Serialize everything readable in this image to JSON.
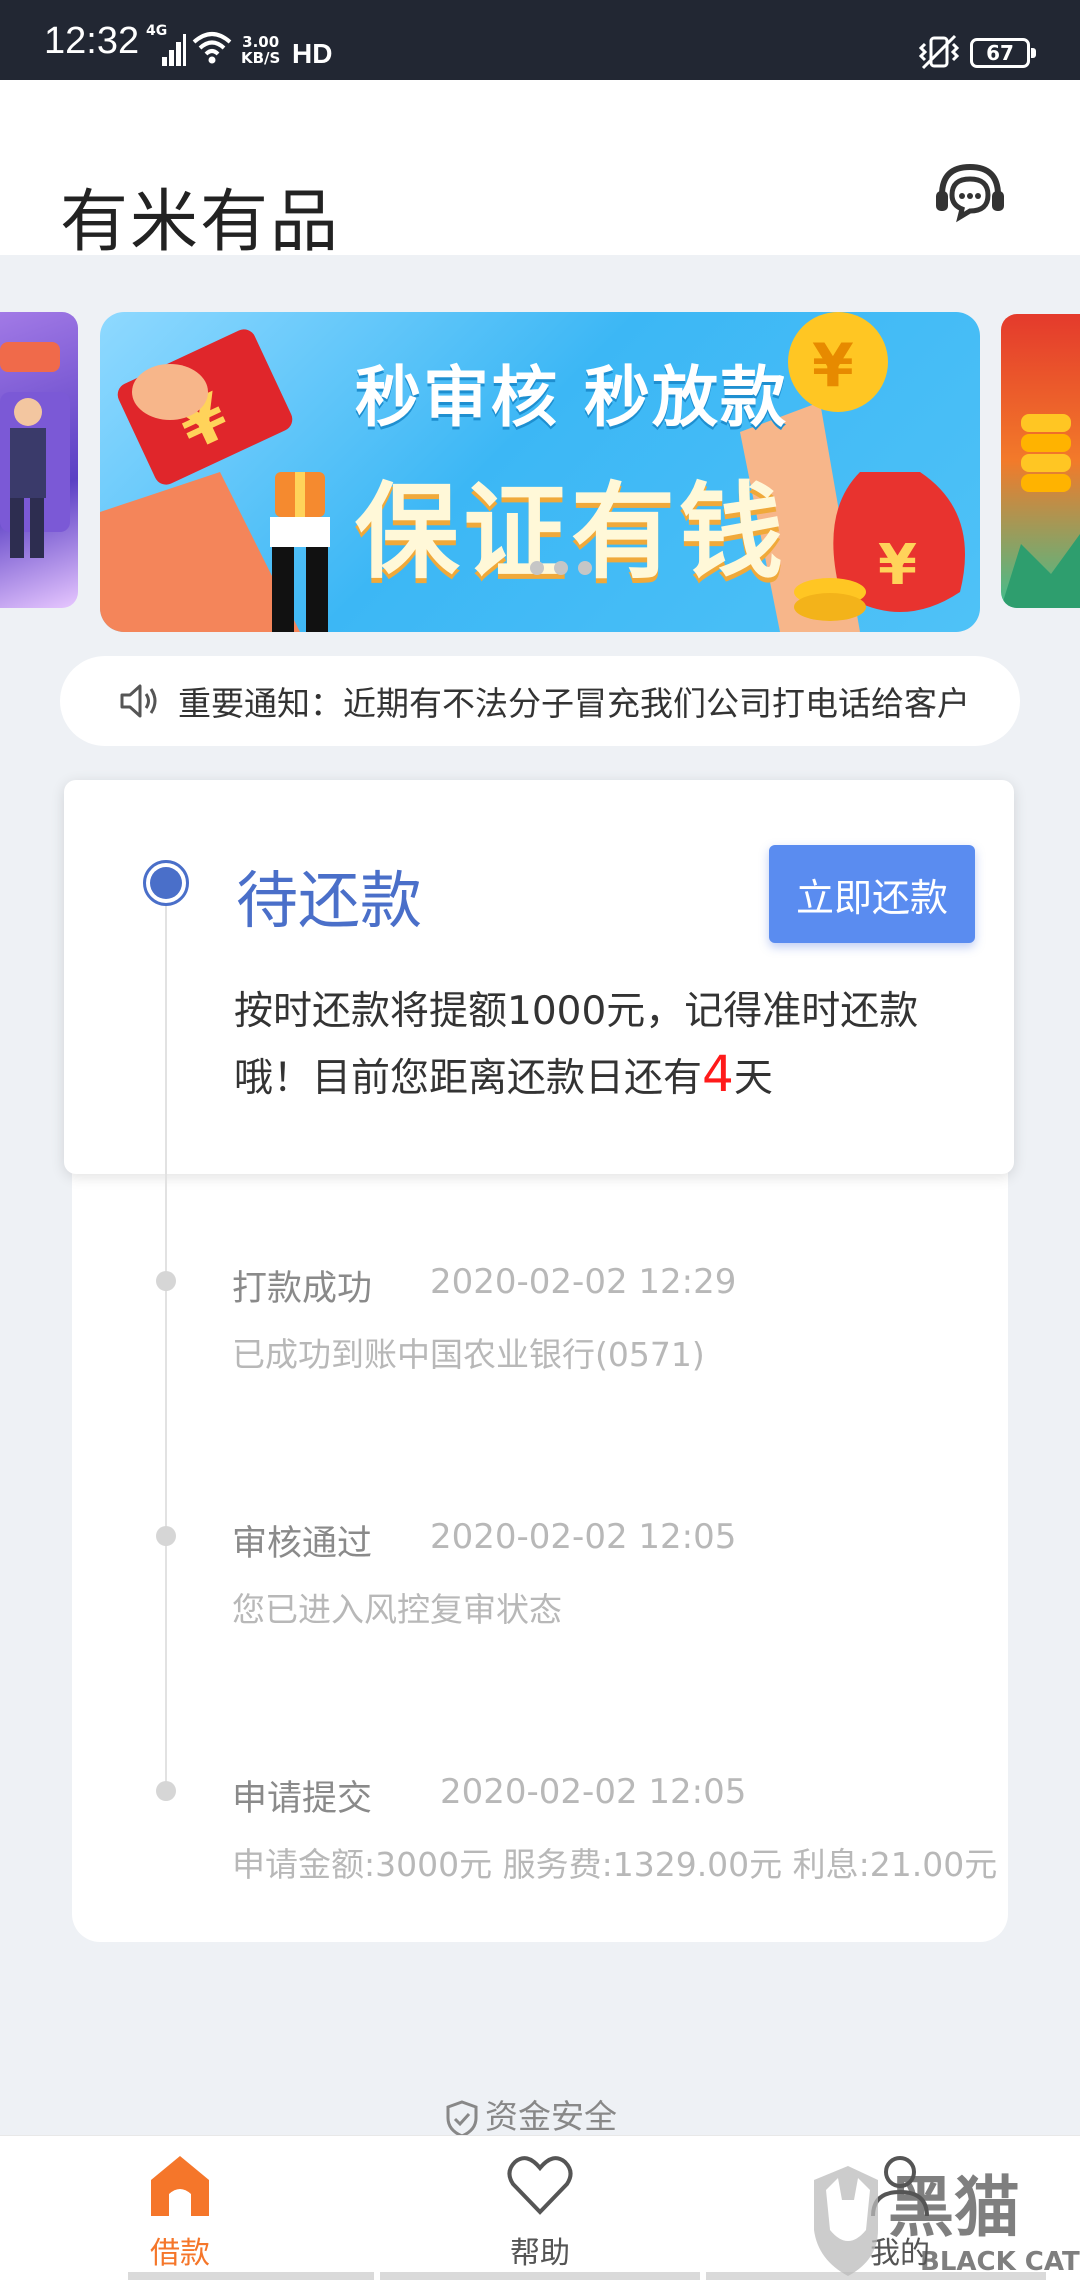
{
  "status_bar": {
    "time": "12:32",
    "network": "4G",
    "speed_value": "3.00",
    "speed_unit": "KB/S",
    "hd": "HD",
    "battery": "67"
  },
  "header": {
    "title": "有米有品",
    "customer_service_icon": "headset-chat-icon"
  },
  "banner": {
    "subtitle": "秒审核 秒放款",
    "title": "保证有钱",
    "dot_count": 3
  },
  "notice": {
    "icon": "speaker-icon",
    "text": "重要通知：近期有不法分子冒充我们公司打电话给客户"
  },
  "repayment_card": {
    "status": "待还款",
    "button_label": "立即还款",
    "desc_before": "按时还款将提额1000元，记得准时还款哦！目前您距离还款日还有",
    "days": "4",
    "desc_after": "天",
    "accent": "#4a6fc9"
  },
  "timeline": [
    {
      "title": "打款成功",
      "time": "2020-02-02 12:29",
      "desc": "已成功到账中国农业银行(0571)"
    },
    {
      "title": "审核通过",
      "time": "2020-02-02 12:05",
      "desc": "您已进入风控复审状态"
    },
    {
      "title": "申请提交",
      "time": "2020-02-02 12:05",
      "desc": "申请金额:3000元  服务费:1329.00元 利息:21.00元"
    }
  ],
  "footer": {
    "safety_text": "资金安全",
    "safety_icon": "shield-check-icon"
  },
  "tabs": [
    {
      "label": "借款",
      "icon": "home-icon",
      "active": true,
      "color": "#f5762a"
    },
    {
      "label": "帮助",
      "icon": "heart-icon",
      "active": false,
      "color": "#555555"
    },
    {
      "label": "我的",
      "icon": "user-icon",
      "active": false,
      "color": "#555555"
    }
  ],
  "watermark": {
    "text_cn": "黑猫",
    "text_en": "BLACK CAT"
  }
}
